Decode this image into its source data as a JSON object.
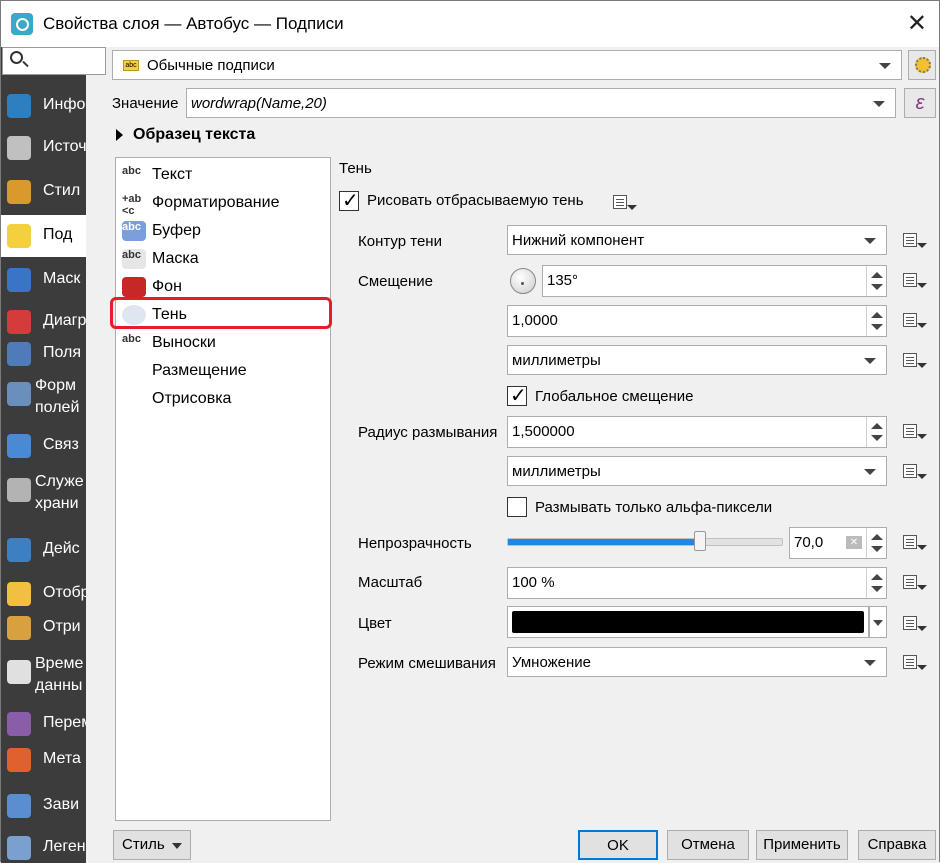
{
  "window": {
    "title": "Свойства слоя — Автобус — Подписи"
  },
  "sidebar": {
    "search_placeholder": "",
    "items": [
      {
        "label": "Инфо",
        "icon": "info-icon",
        "color": "#2e7fc0"
      },
      {
        "label": "Источ",
        "icon": "source-icon",
        "color": "#c0c0c0"
      },
      {
        "label": "Стил",
        "icon": "style-icon",
        "color": "#d89a2b"
      },
      {
        "label": "Под",
        "icon": "labels-icon",
        "color": "#f4d03f"
      },
      {
        "label": "Маск",
        "icon": "mask-icon",
        "color": "#3a74c7"
      },
      {
        "label": "Диагр",
        "icon": "diagram-icon",
        "color": "#d63b3b"
      },
      {
        "label": "Поля",
        "icon": "fields-icon",
        "color": "#4f7bb8"
      },
      {
        "label": "Форм полей",
        "icon": "form-icon",
        "color": "#6a8fbd"
      },
      {
        "label": "Связ",
        "icon": "joins-icon",
        "color": "#4a8ad4"
      },
      {
        "label": "Служе храни",
        "icon": "storage-icon",
        "color": "#b3b3b3"
      },
      {
        "label": "Дейс",
        "icon": "actions-icon",
        "color": "#3d7fc1"
      },
      {
        "label": "Отобр",
        "icon": "display-icon",
        "color": "#f2c040"
      },
      {
        "label": "Отри",
        "icon": "rendering-icon",
        "color": "#d9a040"
      },
      {
        "label": "Време данны",
        "icon": "time-icon",
        "color": "#e0e0e0"
      },
      {
        "label": "Перем",
        "icon": "variables-icon",
        "color": "#8a5da8"
      },
      {
        "label": "Мета",
        "icon": "metadata-icon",
        "color": "#e06030"
      },
      {
        "label": "Зави",
        "icon": "dependencies-icon",
        "color": "#5a8ed0"
      },
      {
        "label": "Леген",
        "icon": "legend-icon",
        "color": "#7aa0d0"
      }
    ]
  },
  "top": {
    "mode_combo": "Обычные подписи",
    "value_label": "Значение",
    "value_expr": "wordwrap(Name,20)",
    "sample_header": "Образец текста",
    "expr_button": "ε"
  },
  "list": {
    "items": [
      {
        "label": "Текст",
        "icon_text": "abc"
      },
      {
        "label": "Форматирование",
        "icon_text": "+ab <c"
      },
      {
        "label": "Буфер",
        "icon_text": "abc"
      },
      {
        "label": "Маска",
        "icon_text": "abc"
      },
      {
        "label": "Фон",
        "icon_text": ""
      },
      {
        "label": "Тень",
        "icon_text": ""
      },
      {
        "label": "Выноски",
        "icon_text": "abc"
      },
      {
        "label": "Размещение",
        "icon_text": ""
      },
      {
        "label": "Отрисовка",
        "icon_text": ""
      }
    ],
    "selected": "Тень",
    "highlight_color": "#e51e25"
  },
  "shadow": {
    "section_title": "Тень",
    "draw_shadow_label": "Рисовать отбрасываемую тень",
    "draw_shadow_checked": true,
    "contour_label": "Контур тени",
    "contour_value": "Нижний компонент",
    "offset_label": "Смещение",
    "offset_angle": "135°",
    "offset_distance": "1,0000",
    "offset_units": "миллиметры",
    "global_offset_label": "Глобальное смещение",
    "global_offset_checked": true,
    "blur_label": "Радиус размывания",
    "blur_value": "1,500000",
    "blur_units": "миллиметры",
    "blur_alpha_label": "Размывать только альфа-пиксели",
    "blur_alpha_checked": false,
    "opacity_label": "Непрозрачность",
    "opacity_value": "70,0",
    "opacity_fraction": 0.7,
    "scale_label": "Масштаб",
    "scale_value": "100 %",
    "color_label": "Цвет",
    "color_value": "#000000",
    "blend_label": "Режим смешивания",
    "blend_value": "Умножение"
  },
  "buttons": {
    "style": "Стиль",
    "ok": "OK",
    "cancel": "Отмена",
    "apply": "Применить",
    "help": "Справка"
  }
}
